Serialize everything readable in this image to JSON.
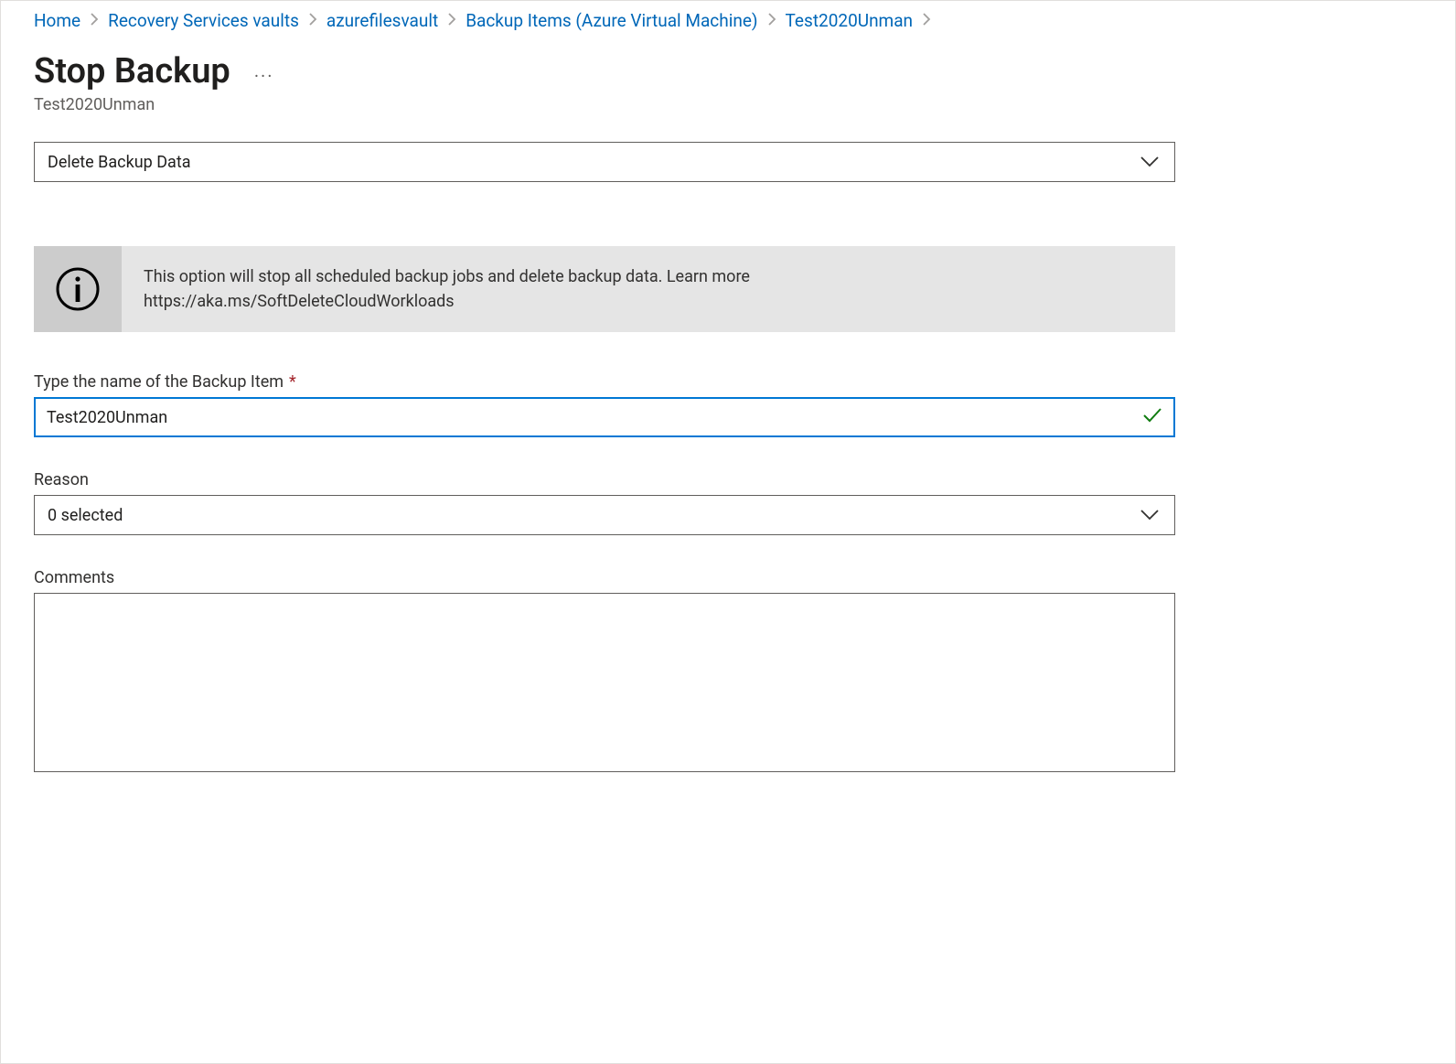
{
  "breadcrumb": {
    "items": [
      {
        "label": "Home"
      },
      {
        "label": "Recovery Services vaults"
      },
      {
        "label": "azurefilesvault"
      },
      {
        "label": "Backup Items (Azure Virtual Machine)"
      },
      {
        "label": "Test2020Unman"
      }
    ]
  },
  "header": {
    "title": "Stop Backup",
    "subtitle": "Test2020Unman"
  },
  "action_dropdown": {
    "value": "Delete Backup Data"
  },
  "info_banner": {
    "line1": "This option will stop all scheduled backup jobs and delete backup data. Learn more",
    "line2": "https://aka.ms/SoftDeleteCloudWorkloads"
  },
  "fields": {
    "name": {
      "label": "Type the name of the Backup Item",
      "required_marker": "*",
      "value": "Test2020Unman"
    },
    "reason": {
      "label": "Reason",
      "value": "0 selected"
    },
    "comments": {
      "label": "Comments",
      "value": ""
    }
  }
}
